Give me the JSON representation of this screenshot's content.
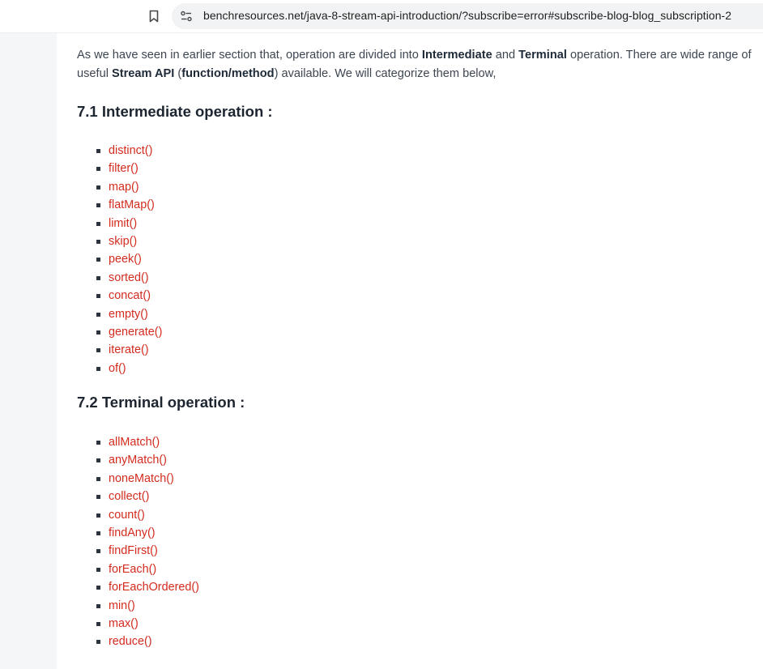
{
  "browser": {
    "url": "benchresources.net/java-8-stream-api-introduction/?subscribe=error#subscribe-blog-blog_subscription-2"
  },
  "article": {
    "intro": {
      "p1": "As we have seen in earlier section that, operation are divided into ",
      "b1": "Intermediate",
      "p2": " and ",
      "b2": "Terminal",
      "p3": " operation. There are wide range of useful ",
      "b3": "Stream API",
      "p4": " (",
      "b4": "function/method",
      "p5": ") available. We will categorize them below,"
    },
    "intermediate_heading": "7.1 Intermediate operation :",
    "intermediate_ops": [
      "distinct()",
      "filter()",
      "map()",
      "flatMap()",
      "limit()",
      "skip()",
      "peek()",
      "sorted()",
      "concat()",
      "empty()",
      "generate()",
      "iterate()",
      "of()"
    ],
    "terminal_heading": "7.2 Terminal operation :",
    "terminal_ops": [
      "allMatch()",
      "anyMatch()",
      "noneMatch()",
      "collect()",
      "count()",
      "findAny()",
      "findFirst()",
      "forEach()",
      "forEachOrdered()",
      "min()",
      "max()",
      "reduce()"
    ]
  },
  "colors": {
    "link": "#d32b1e",
    "text": "#3e4652",
    "heading": "#1d2530",
    "gutter": "#f5f6f8"
  },
  "icons": {
    "bookmark": "bookmark-icon",
    "site_info": "site-settings-icon"
  }
}
